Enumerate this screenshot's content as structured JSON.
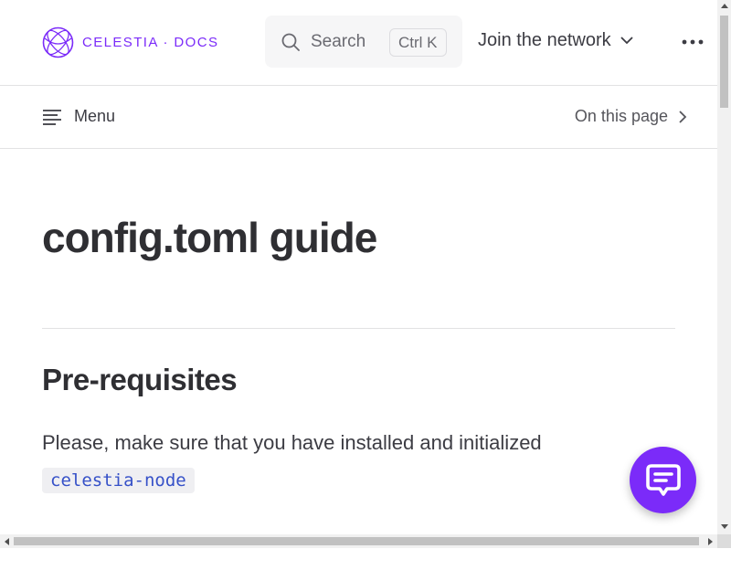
{
  "header": {
    "logo_text": "CELESTIA · DOCS",
    "search": {
      "label": "Search",
      "shortcut": "Ctrl K"
    },
    "nav_dropdown": "Join the network",
    "more_icon": "more-dots-icon"
  },
  "local_nav": {
    "menu_label": "Menu",
    "on_this_page_label": "On this page"
  },
  "main": {
    "title": "config.toml guide",
    "section_heading": "Pre-requisites",
    "paragraph": "Please, make sure that you have installed and initialized",
    "code": "celestia-node"
  },
  "chat_button": {
    "icon": "chat-bubble-icon"
  },
  "colors": {
    "brand": "#7b2bf9",
    "text": "#3c3c43",
    "code": "#3651c8",
    "divider": "#e2e2e3"
  }
}
